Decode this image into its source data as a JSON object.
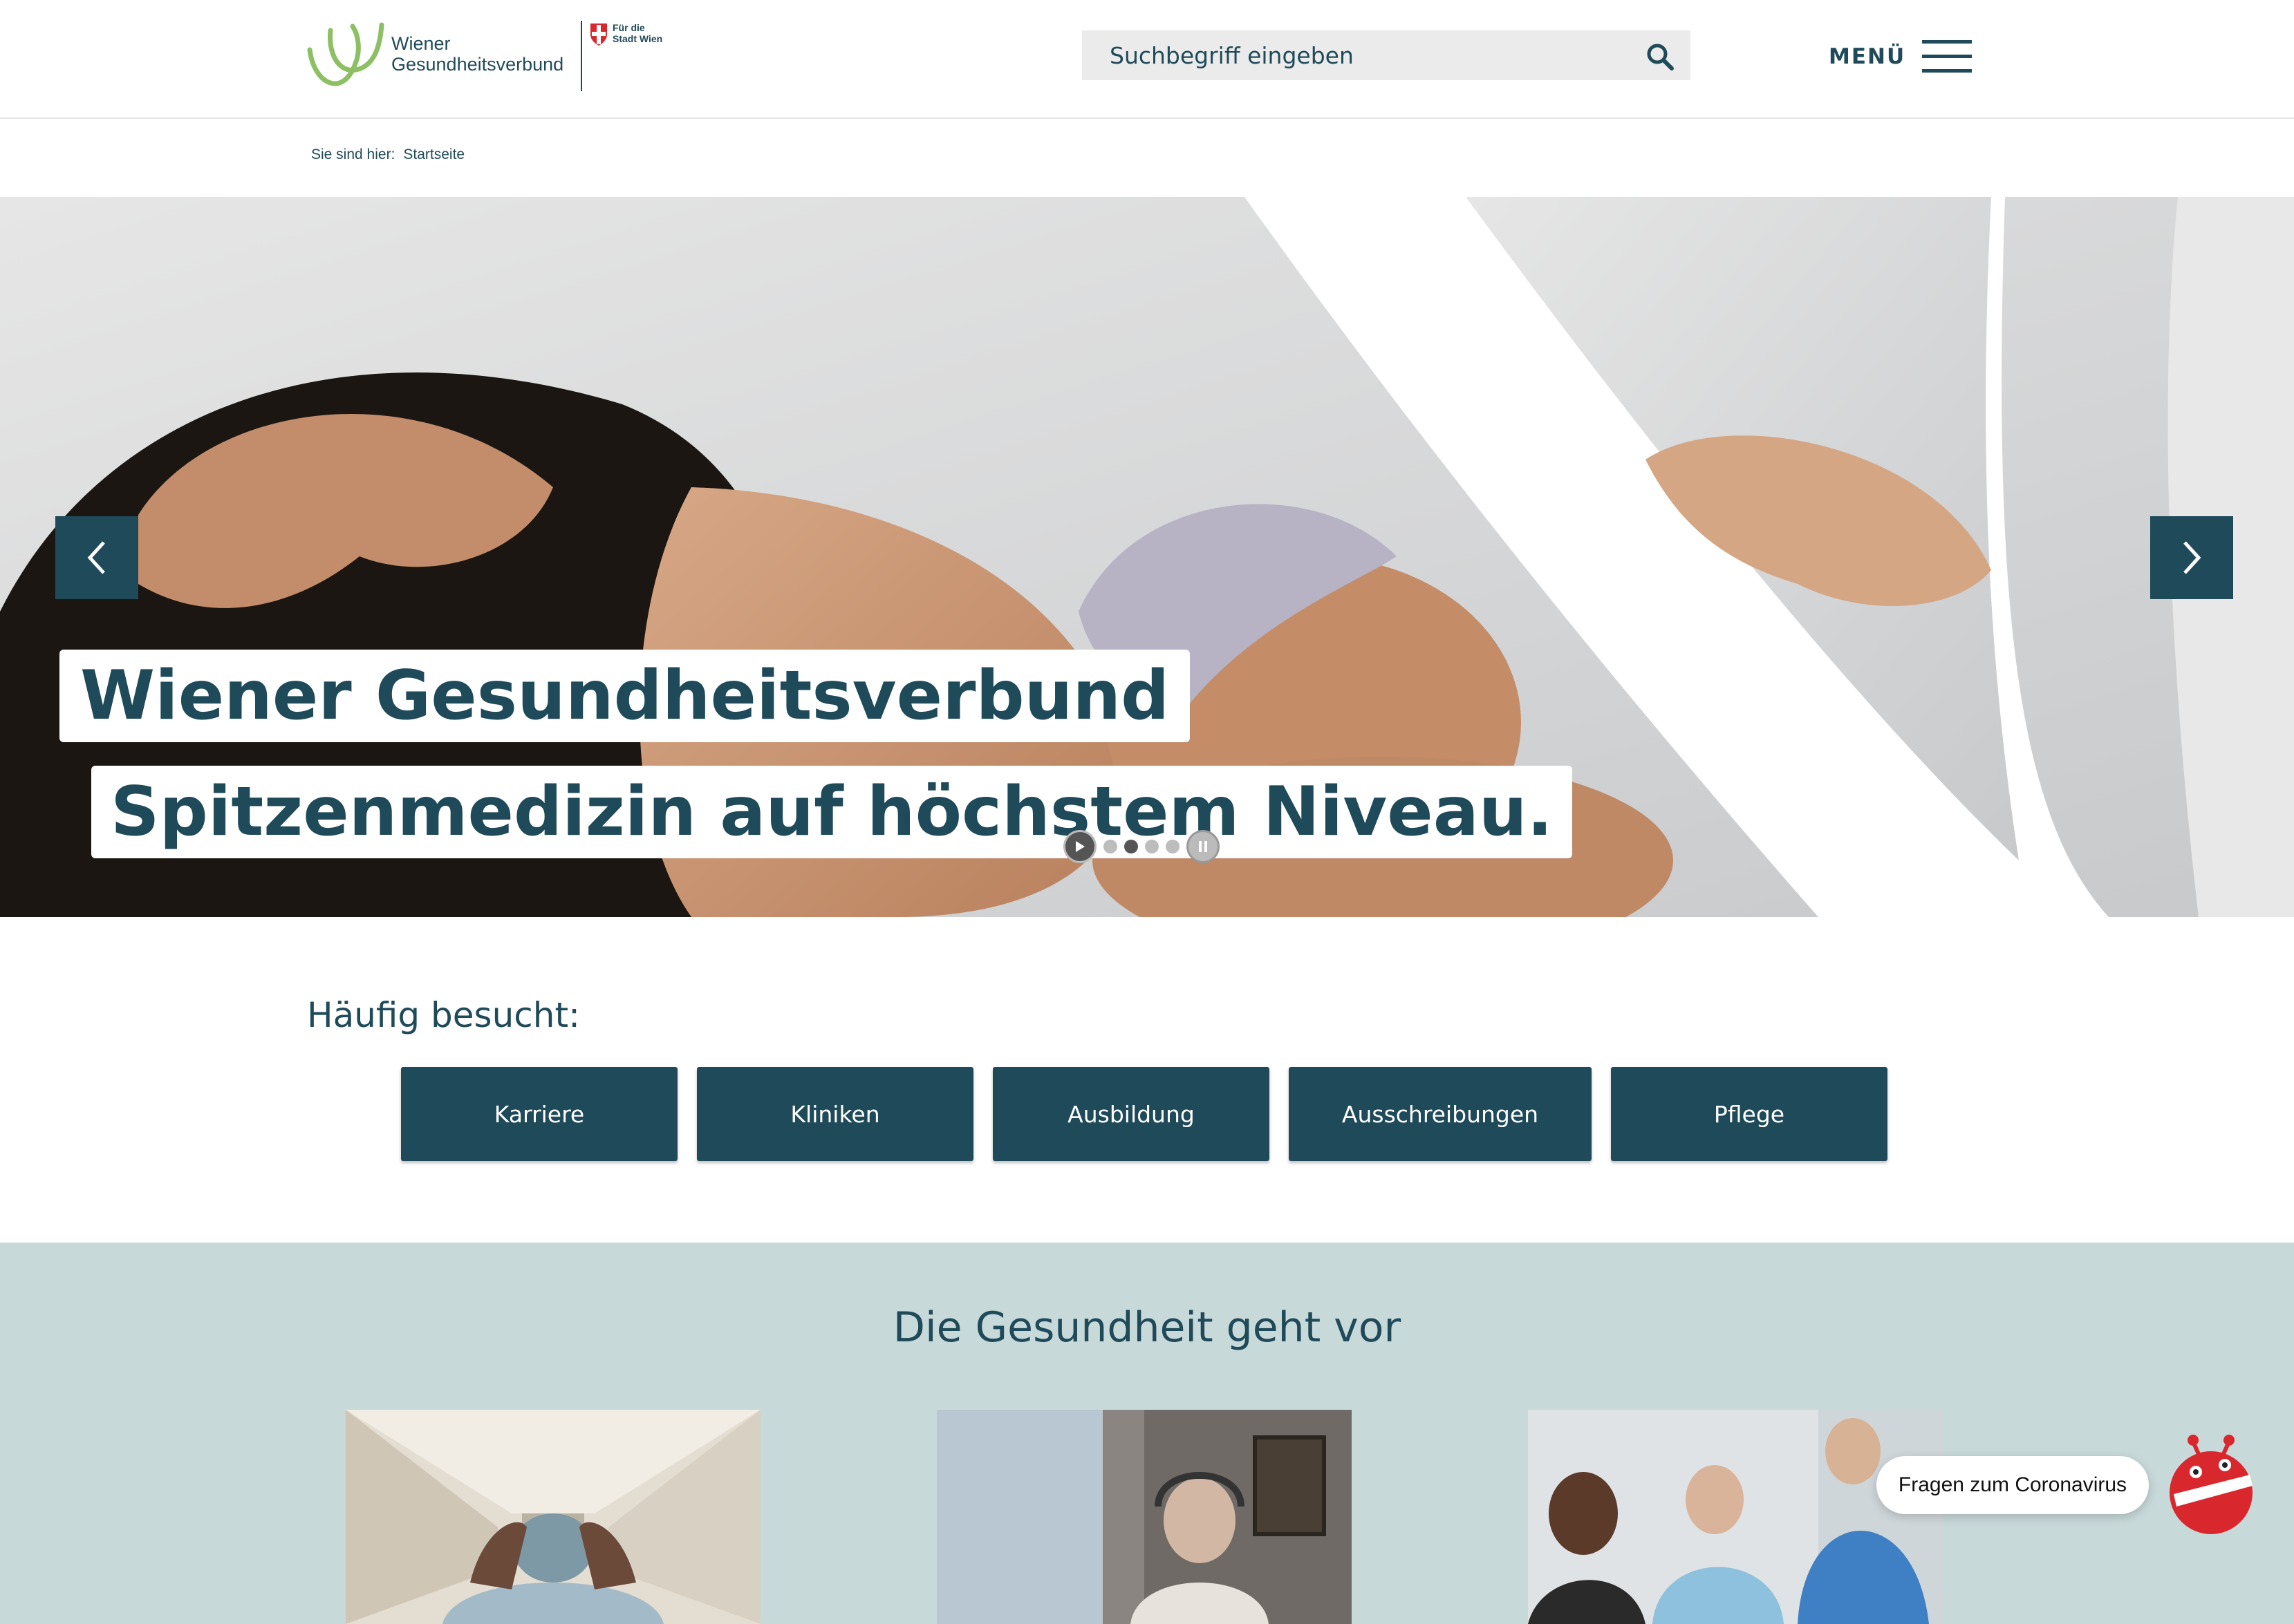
{
  "header": {
    "logo_line1": "Wiener",
    "logo_line2": "Gesundheitsverbund",
    "city_line1": "Für die",
    "city_line2": "Stadt Wien",
    "search_placeholder": "Suchbegriff eingeben",
    "menu_label": "MENÜ"
  },
  "breadcrumb": {
    "prefix": "Sie sind hier:",
    "current": "Startseite"
  },
  "hero": {
    "headline_1": "Wiener Gesundheitsverbund",
    "headline_2": "Spitzenmedizin auf höchstem Niveau.",
    "slide_count": 4,
    "active_slide": 2
  },
  "frequent": {
    "title": "Häufig besucht:",
    "buttons": [
      "Karriere",
      "Kliniken",
      "Ausbildung",
      "Ausschreibungen",
      "Pflege"
    ]
  },
  "teaser": {
    "title": "Die Gesundheit geht vor"
  },
  "chat": {
    "label": "Fragen zum Coronavirus"
  },
  "colors": {
    "primary": "#1f4a59",
    "teaser_bg": "#c8d9da",
    "logo_green": "#8cc063",
    "bot_red": "#d9272e"
  }
}
